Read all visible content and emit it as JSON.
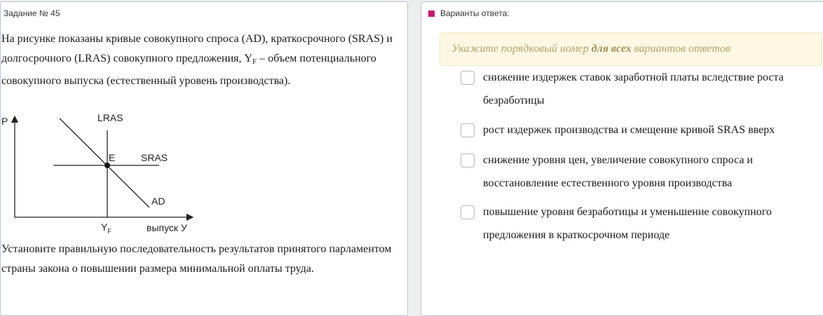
{
  "task": {
    "number_label": "Задание № 45",
    "intro": {
      "part1": "На рисунке показаны кривые совокупного спроса (AD), краткосрочного (SRAS) и долгосрочного (LRAS) совокупного предложения, Y",
      "sub": "F",
      "part2": " – объем потенциального совокупного выпуска (естественный уровень производства)."
    },
    "question": "Установите правильную последовательность результатов принятого парламентом страны закона о повышении размера минимальной оплаты труда."
  },
  "graph": {
    "y_axis_label": "P",
    "lras_label": "LRAS",
    "point_label": "E",
    "sras_label": "SRAS",
    "ad_label": "AD",
    "yf_label": "Y",
    "yf_sub": "F",
    "x_axis_label": "выпуск У"
  },
  "answers": {
    "header": "Варианты ответа:",
    "hint": {
      "before": "Укажите порядковый номер ",
      "bold": "для всех",
      "after": " вариантов ответов"
    },
    "options": [
      "снижение издержек ставок заработной платы вследствие роста безработицы",
      "рост издержек производства и смещение кривой SRAS вверх",
      "снижение уровня цен, увеличение совокупного спроса и восстановление естественного уровня производства",
      "повышение уровня безработицы и уменьшение совокупного предложения в краткосрочном периоде"
    ]
  },
  "colors": {
    "accent_marker": "#d0166e",
    "hint_bg": "#fcf8e3",
    "hint_text": "#b9a169",
    "panel_border": "#b9c4dc"
  }
}
